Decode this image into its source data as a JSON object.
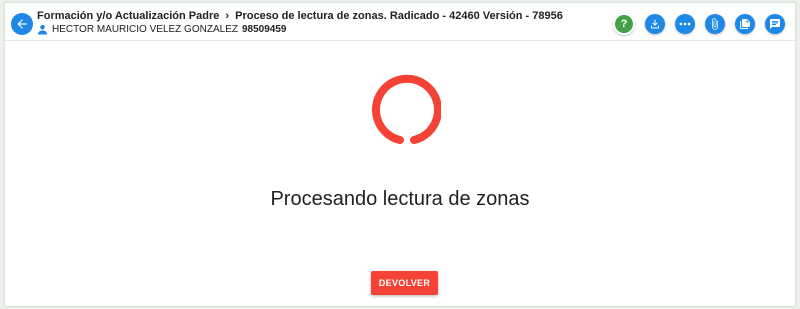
{
  "header": {
    "breadcrumb": {
      "parent": "Formación y/o Actualización Padre",
      "current": "Proceso de lectura de zonas. Radicado - 42460 Versión - 78956"
    },
    "user": {
      "name": "HECTOR MAURICIO VELEZ GONZALEZ",
      "id": "98509459"
    },
    "actions": [
      {
        "name": "help-icon",
        "glyph": "?"
      },
      {
        "name": "download-icon"
      },
      {
        "name": "more-icon"
      },
      {
        "name": "attach-icon"
      },
      {
        "name": "documents-icon"
      },
      {
        "name": "notes-icon"
      }
    ]
  },
  "main": {
    "status_text": "Procesando lectura de zonas",
    "return_button": "DEVOLVER"
  },
  "colors": {
    "accent": "#1e88e5",
    "help": "#43a047",
    "danger": "#f44336"
  }
}
